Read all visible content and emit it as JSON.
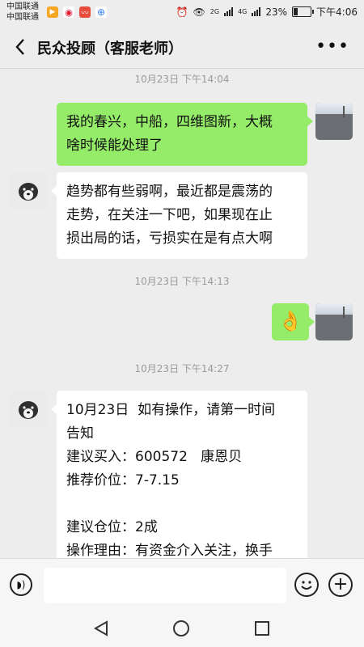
{
  "status_bar": {
    "carrier_1": "中国联通",
    "carrier_2": "中国联通",
    "network_1": "2G",
    "network_2": "4G",
    "battery_percent": "23%",
    "battery_level": 0.23,
    "time": "下午4:06"
  },
  "header": {
    "title": "民众投顾（客服老师）"
  },
  "messages": [
    {
      "type": "timestamp",
      "text": "10月23日 下午14:04"
    },
    {
      "type": "sent",
      "lines": [
        "我的春兴，中船，四维图新，大概",
        "啥时候能处理了"
      ]
    },
    {
      "type": "received",
      "lines": [
        "趋势都有些弱啊，最近都是震荡的",
        "走势，在关注一下吧，如果现在止",
        "损出局的话，亏损实在是有点大啊"
      ]
    },
    {
      "type": "timestamp",
      "text": "10月23日 下午14:13"
    },
    {
      "type": "sent_emoji",
      "emoji": "👌"
    },
    {
      "type": "timestamp",
      "text": "10月23日 下午14:27"
    },
    {
      "type": "received",
      "lines": [
        "10月23日  如有操作，请第一时间",
        "告知",
        "建议买入：600572   康恩贝",
        "推荐价位：7-7.15",
        "",
        "建议仓位：2成",
        "操作理由：有资金介入关注，换手"
      ]
    }
  ],
  "input_bar": {
    "placeholder": ""
  },
  "icons": {
    "back": "chevron-left-icon",
    "more": "more-icon",
    "voice": "voice-icon",
    "emoji": "emoji-icon",
    "plus": "plus-icon"
  },
  "colors": {
    "sent_bubble": "#95ec69",
    "received_bubble": "#ffffff",
    "background": "#ededed"
  }
}
